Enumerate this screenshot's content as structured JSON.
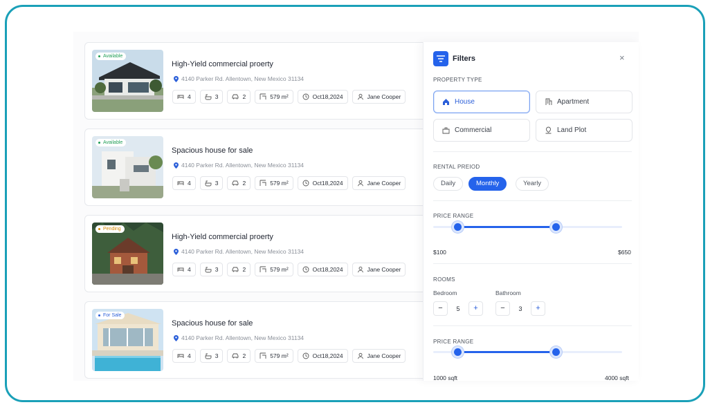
{
  "listings": [
    {
      "badge": "Available",
      "title": "High-Yield commercial proerty",
      "address": "4140 Parker Rd. Allentown, New Mexico 31134",
      "beds": "4",
      "baths": "3",
      "garage": "2",
      "area": "579 m²",
      "date": "Oct18,2024",
      "agent": "Jane Cooper"
    },
    {
      "badge": "Available",
      "title": "Spacious house for sale",
      "address": "4140 Parker Rd. Allentown, New Mexico 31134",
      "beds": "4",
      "baths": "3",
      "garage": "2",
      "area": "579 m²",
      "date": "Oct18,2024",
      "agent": "Jane Cooper"
    },
    {
      "badge": "Pending",
      "title": "High-Yield commercial proerty",
      "address": "4140 Parker Rd. Allentown, New Mexico 31134",
      "beds": "4",
      "baths": "3",
      "garage": "2",
      "area": "579 m²",
      "date": "Oct18,2024",
      "agent": "Jane Cooper"
    },
    {
      "badge": "For Sale",
      "title": "Spacious house for sale",
      "address": "4140 Parker Rd. Allentown, New Mexico 31134",
      "beds": "4",
      "baths": "3",
      "garage": "2",
      "area": "579 m²",
      "date": "Oct18,2024",
      "agent": "Jane Cooper"
    }
  ],
  "filters": {
    "title": "Filters",
    "close": "×",
    "property_type_label": "PROPERTY TYPE",
    "property_types": [
      "House",
      "Apartment",
      "Commercial",
      "Land Plot"
    ],
    "property_type_selected": "House",
    "rental_period_label": "RENTAL PREIOD",
    "rental_periods": [
      "Daily",
      "Monthly",
      "Yearly"
    ],
    "rental_period_selected": "Monthly",
    "price_range_label": "PRICE RANGE",
    "price_min": "$100",
    "price_max": "$650",
    "price_handles": [
      0.13,
      0.65
    ],
    "rooms_label": "ROOMS",
    "bedroom_label": "Bedroom",
    "bedroom_value": "5",
    "bathroom_label": "Bathroom",
    "bathroom_value": "3",
    "minus": "−",
    "plus": "+",
    "area_range_label": "PRICE RANGE",
    "area_min": "1000 sqft",
    "area_max": "4000 sqft",
    "area_handles": [
      0.13,
      0.65
    ]
  },
  "colors": {
    "accent": "#2563eb",
    "available": "#1f9d55",
    "pending": "#d68a00",
    "frame_border": "#1aa0b8"
  }
}
